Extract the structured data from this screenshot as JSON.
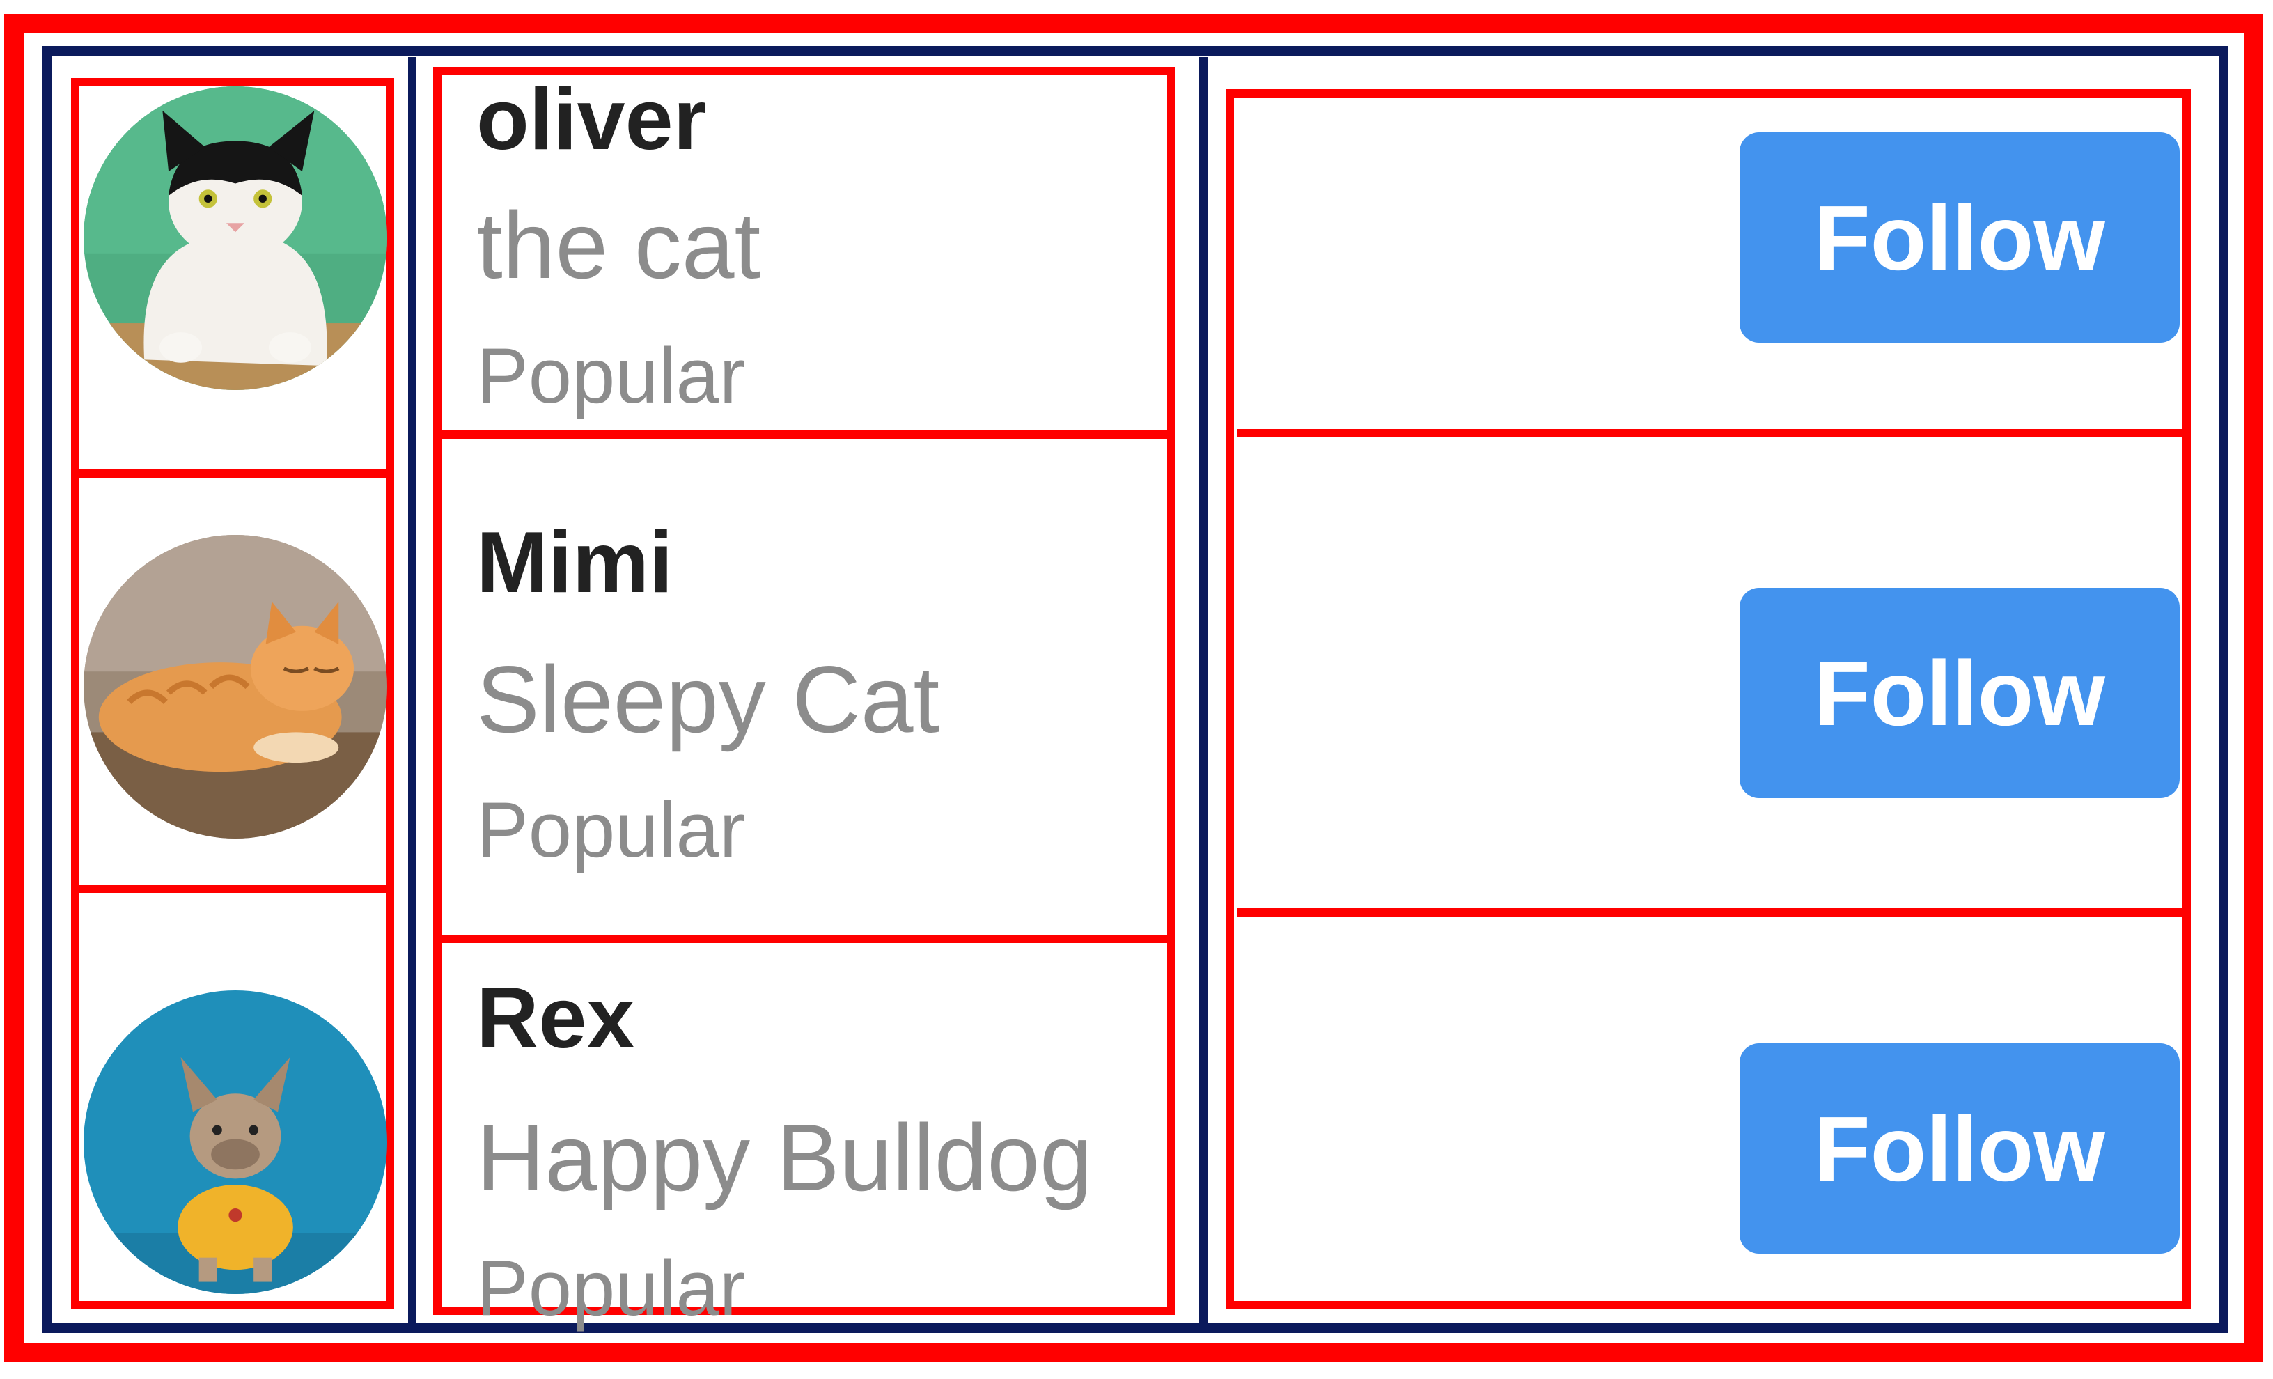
{
  "accent_color": "#4393ee",
  "users": [
    {
      "name": "oliver",
      "subtitle": "the cat",
      "badge": "Popular",
      "follow_label": "Follow",
      "avatar": "tuxedo-cat-photo"
    },
    {
      "name": "Mimi",
      "subtitle": "Sleepy Cat",
      "badge": "Popular",
      "follow_label": "Follow",
      "avatar": "orange-tabby-cat-photo"
    },
    {
      "name": "Rex",
      "subtitle": "Happy Bulldog",
      "badge": "Popular",
      "follow_label": "Follow",
      "avatar": "french-bulldog-photo"
    }
  ]
}
